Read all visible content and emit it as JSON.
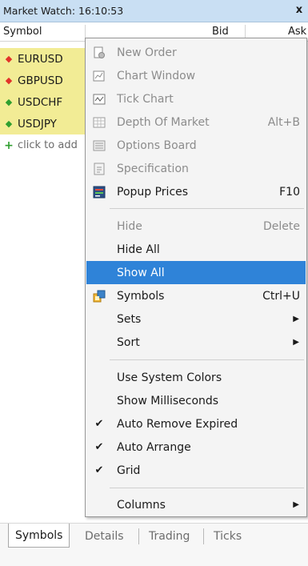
{
  "window": {
    "title": "Market Watch: 16:10:53",
    "close_glyph": "x"
  },
  "columns": {
    "symbol": "Symbol",
    "bid": "Bid",
    "ask": "Ask"
  },
  "symbols": [
    {
      "name": "EURUSD",
      "direction": "down"
    },
    {
      "name": "GBPUSD",
      "direction": "down"
    },
    {
      "name": "USDCHF",
      "direction": "up"
    },
    {
      "name": "USDJPY",
      "direction": "up"
    }
  ],
  "add_row": {
    "label": "click to add"
  },
  "menu": {
    "new_order": "New Order",
    "chart_window": "Chart Window",
    "tick_chart": "Tick Chart",
    "depth_of_market": "Depth Of Market",
    "depth_of_market_shortcut": "Alt+B",
    "options_board": "Options Board",
    "specification": "Specification",
    "popup_prices": "Popup Prices",
    "popup_prices_shortcut": "F10",
    "hide": "Hide",
    "hide_shortcut": "Delete",
    "hide_all": "Hide All",
    "show_all": "Show All",
    "symbols": "Symbols",
    "symbols_shortcut": "Ctrl+U",
    "sets": "Sets",
    "sort": "Sort",
    "use_system_colors": "Use System Colors",
    "show_milliseconds": "Show Milliseconds",
    "auto_remove_expired": "Auto Remove Expired",
    "auto_arrange": "Auto Arrange",
    "grid": "Grid",
    "columns": "Columns"
  },
  "tabs": [
    "Symbols",
    "Details",
    "Trading",
    "Ticks"
  ],
  "colors": {
    "titlebar": "#c9dff3",
    "symbol_row": "#f2ec95",
    "selection": "#2f83d8",
    "arrow_down": "#e2322a",
    "arrow_up": "#2f9f2f"
  }
}
